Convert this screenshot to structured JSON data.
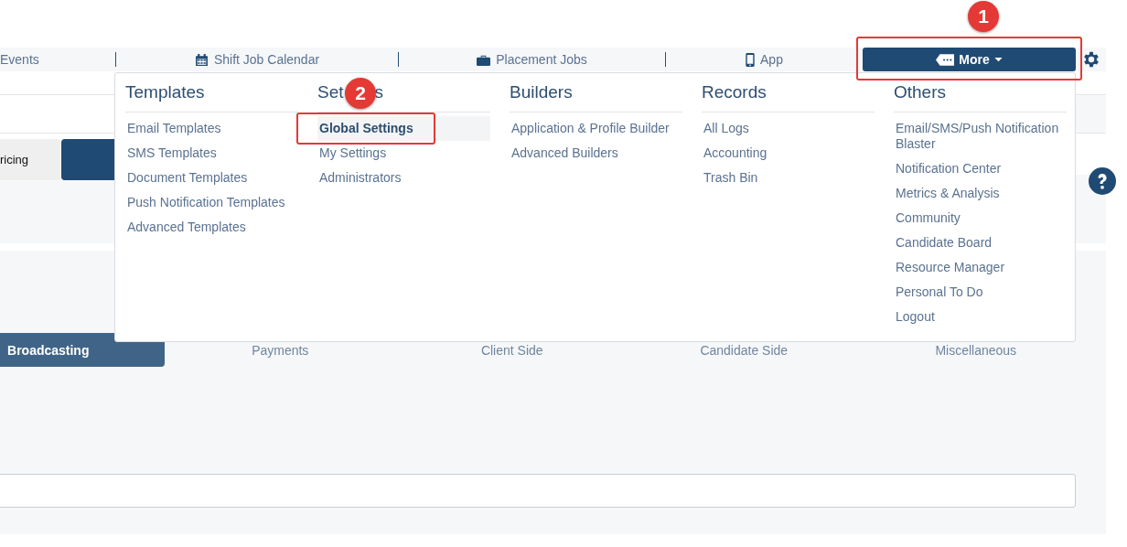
{
  "nav": {
    "items": [
      {
        "label": "Events"
      },
      {
        "label": "Shift Job Calendar"
      },
      {
        "label": "Placement Jobs"
      },
      {
        "label": "App"
      }
    ],
    "more_button": {
      "label": "More",
      "expanded": true
    }
  },
  "side_tabs": [
    {
      "label": "ricing",
      "selected": false
    },
    {
      "selected": true
    }
  ],
  "menu": {
    "columns": [
      {
        "title": "Templates",
        "items": [
          {
            "label": "Email Templates",
            "selected": false
          },
          {
            "label": "SMS Templates",
            "selected": false
          },
          {
            "label": "Document Templates",
            "selected": false
          },
          {
            "label": "Push Notification Templates",
            "selected": false
          },
          {
            "label": "Advanced Templates",
            "selected": false
          }
        ]
      },
      {
        "title": "Set",
        "title_end": "s",
        "items": [
          {
            "label": "Global Settings",
            "selected": true
          },
          {
            "label": "My Settings",
            "selected": false
          },
          {
            "label": "Administrators",
            "selected": false
          }
        ]
      },
      {
        "title": "Builders",
        "items": [
          {
            "label": "Application & Profile Builder",
            "selected": false
          },
          {
            "label": "Advanced Builders",
            "selected": false
          }
        ]
      },
      {
        "title": "Records",
        "items": [
          {
            "label": "All Logs",
            "selected": false
          },
          {
            "label": "Accounting",
            "selected": false
          },
          {
            "label": "Trash Bin",
            "selected": false
          }
        ]
      },
      {
        "title": "Others",
        "items": [
          {
            "label": "Email/SMS/Push Notification Blaster",
            "selected": false
          },
          {
            "label": "Notification Center",
            "selected": false
          },
          {
            "label": "Metrics & Analysis",
            "selected": false
          },
          {
            "label": "Community",
            "selected": false
          },
          {
            "label": "Candidate Board",
            "selected": false
          },
          {
            "label": "Resource Manager",
            "selected": false
          },
          {
            "label": "Personal To Do",
            "selected": false
          },
          {
            "label": "Logout",
            "selected": false
          }
        ]
      }
    ]
  },
  "settings_tabs": [
    {
      "label": "Broadcasting",
      "selected": true
    },
    {
      "label": "Payments",
      "selected": false
    },
    {
      "label": "Client Side",
      "selected": false
    },
    {
      "label": "Candidate Side",
      "selected": false
    },
    {
      "label": "Miscellaneous",
      "selected": false
    }
  ],
  "annotations": [
    {
      "label": "1"
    },
    {
      "label": "2"
    }
  ]
}
